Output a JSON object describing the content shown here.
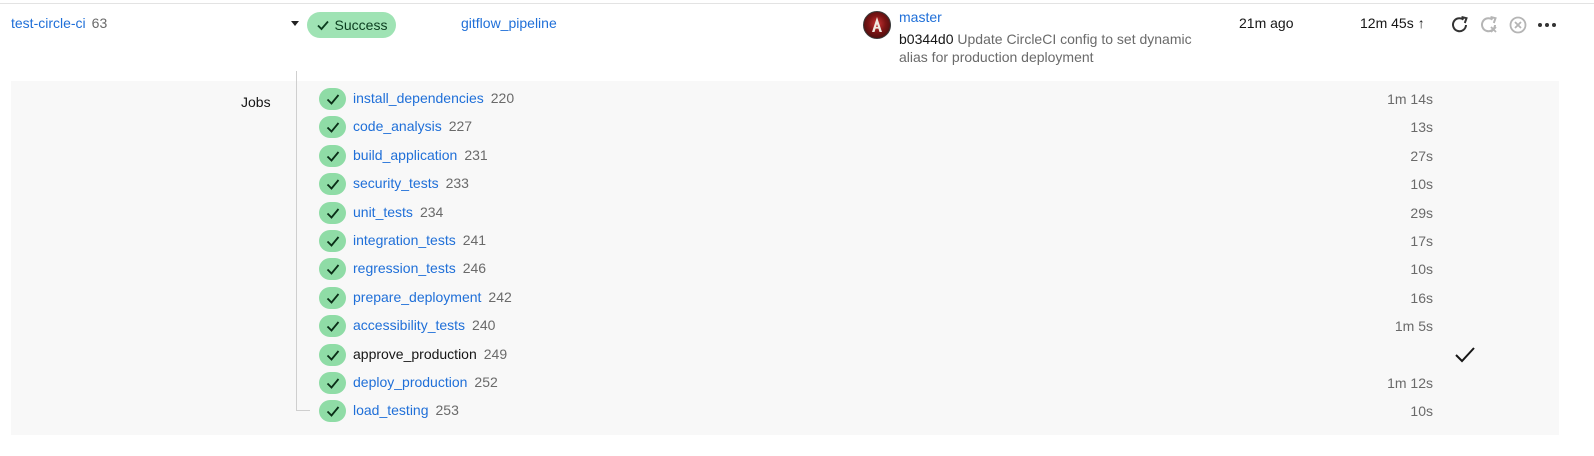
{
  "pipeline": {
    "project_name": "test-circle-ci",
    "pipeline_number": "63",
    "status_label": "Success",
    "workflow_name": "gitflow_pipeline",
    "branch": "master",
    "commit_sha": "b0344d0",
    "commit_message": "Update CircleCI config to set dynamic alias for production deployment",
    "time_ago": "21m ago",
    "duration": "12m 45s",
    "duration_arrow": "↑",
    "actions": [
      "rerun-icon",
      "rerun-failed-icon",
      "cancel-icon",
      "more-icon"
    ]
  },
  "jobs_section": {
    "label": "Jobs",
    "jobs": [
      {
        "name": "install_dependencies",
        "number": "220",
        "duration": "1m 14s",
        "link": true
      },
      {
        "name": "code_analysis",
        "number": "227",
        "duration": "13s",
        "link": true
      },
      {
        "name": "build_application",
        "number": "231",
        "duration": "27s",
        "link": true
      },
      {
        "name": "security_tests",
        "number": "233",
        "duration": "10s",
        "link": true
      },
      {
        "name": "unit_tests",
        "number": "234",
        "duration": "29s",
        "link": true
      },
      {
        "name": "integration_tests",
        "number": "241",
        "duration": "17s",
        "link": true
      },
      {
        "name": "regression_tests",
        "number": "246",
        "duration": "10s",
        "link": true
      },
      {
        "name": "prepare_deployment",
        "number": "242",
        "duration": "16s",
        "link": true
      },
      {
        "name": "accessibility_tests",
        "number": "240",
        "duration": "1m 5s",
        "link": true
      },
      {
        "name": "approve_production",
        "number": "249",
        "duration": "",
        "link": false,
        "approved": true
      },
      {
        "name": "deploy_production",
        "number": "252",
        "duration": "1m 12s",
        "link": true
      },
      {
        "name": "load_testing",
        "number": "253",
        "duration": "10s",
        "link": true
      }
    ]
  },
  "colors": {
    "success_pill": "#9fe3b4",
    "job_check": "#8fdca6",
    "link": "#1f6fd8",
    "panel_bg": "#f8f8f8"
  }
}
